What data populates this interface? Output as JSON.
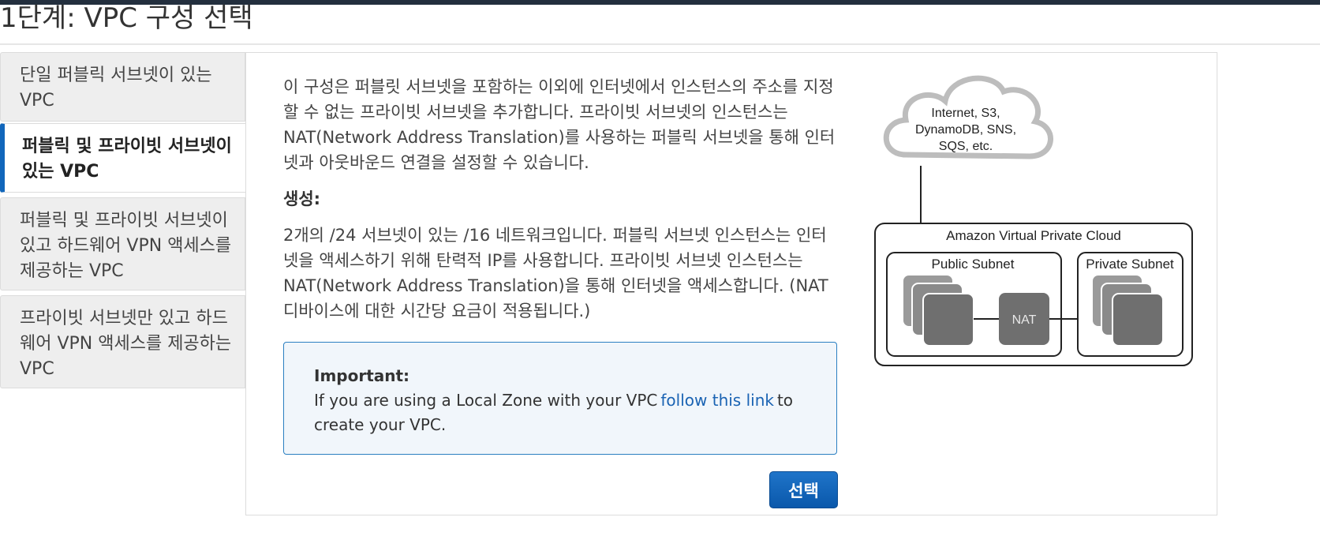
{
  "page_title": "1단계: VPC 구성 선택",
  "sidebar": {
    "items": [
      {
        "label": "단일 퍼블릭 서브넷이 있는 VPC"
      },
      {
        "label": "퍼블릭 및 프라이빗 서브넷이 있는 VPC",
        "active": true
      },
      {
        "label": "퍼블릭 및 프라이빗 서브넷이 있고 하드웨어 VPN 액세스를 제공하는 VPC"
      },
      {
        "label": "프라이빗 서브넷만 있고 하드웨어 VPN 액세스를 제공하는 VPC"
      }
    ]
  },
  "main": {
    "description": "이 구성은 퍼블릿 서브넷을 포함하는 이외에 인터넷에서 인스턴스의 주소를 지정할 수 없는 프라이빗 서브넷을 추가합니다. 프라이빗 서브넷의 인스턴스는 NAT(Network Address Translation)를 사용하는 퍼블릭 서브넷을 통해 인터넷과 아웃바운드 연결을 설정할 수 있습니다.",
    "creation_heading": "생성:",
    "creation_text": "2개의 /24 서브넷이 있는 /16 네트워크입니다. 퍼블릭 서브넷 인스턴스는 인터넷을 액세스하기 위해 탄력적 IP를 사용합니다. 프라이빗 서브넷 인스턴스는 NAT(Network Address Translation)을 통해 인터넷을 액세스합니다. (NAT 디바이스에 대한 시간당 요금이 적용됩니다.)",
    "notice": {
      "heading": "Important:",
      "text_before": "If you are using a Local Zone with your VPC",
      "link": "follow this link",
      "text_after": "to create your VPC.",
      "border_color": "#2a7fc1",
      "background_color": "#f1f6fb"
    },
    "select_button": "선택"
  },
  "diagram": {
    "cloud_lines": [
      "Internet, S3,",
      "DynamoDB, SNS,",
      "SQS, etc."
    ],
    "vpc_label": "Amazon Virtual Private Cloud",
    "public_subnet": "Public Subnet",
    "private_subnet": "Private Subnet",
    "nat_label": "NAT"
  },
  "colors": {
    "accent": "#1166bb",
    "button": "#0a58ab",
    "link": "#1a63b3",
    "top_bar": "#232f3e"
  }
}
